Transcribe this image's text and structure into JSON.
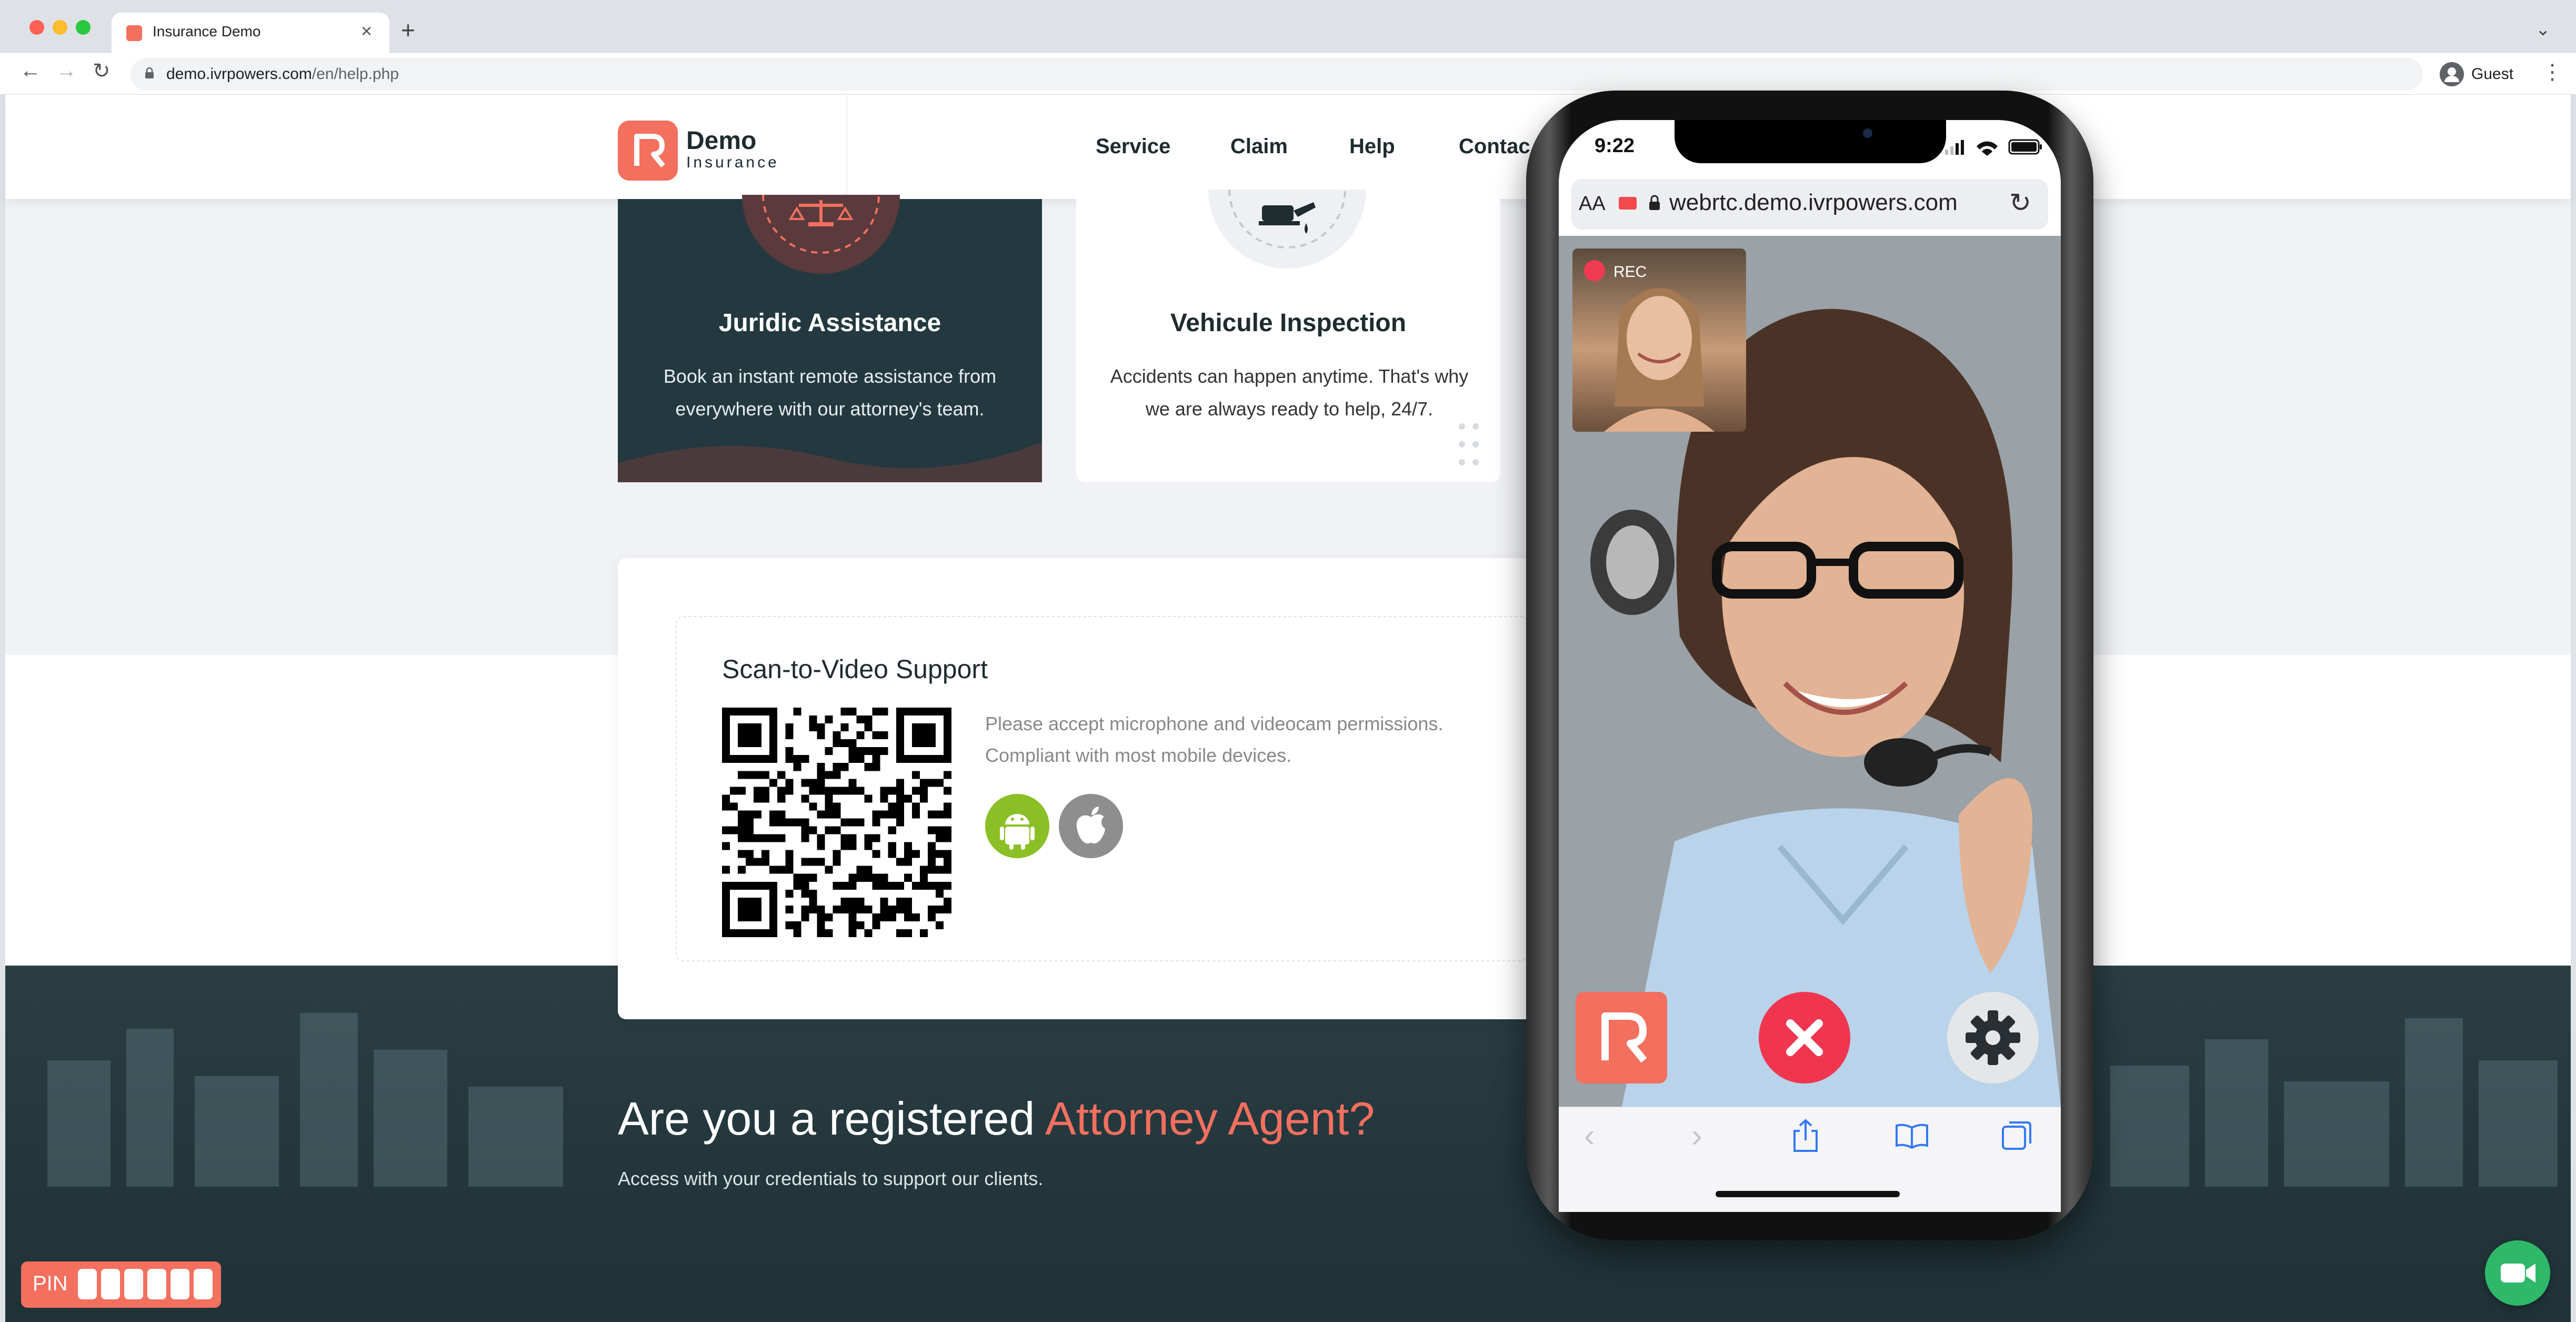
{
  "browser": {
    "tab_title": "Insurance Demo",
    "tab_close": "×",
    "new_tab": "+",
    "tab_menu": "⌄",
    "url_host": "demo.ivrpowers.com",
    "url_path": "/en/help.php",
    "profile_label": "Guest",
    "menu_glyph": "⋮",
    "back_glyph": "←",
    "forward_glyph": "→",
    "reload_glyph": "↻"
  },
  "site": {
    "logo_word1": "Demo",
    "logo_word2": "Insurance",
    "nav": [
      "Service",
      "Claim",
      "Help",
      "Contac"
    ],
    "cards": [
      {
        "title": "Juridic Assistance",
        "desc": "Book an instant remote assistance from everywhere with our attorney's team."
      },
      {
        "title": "Vehicule Inspection",
        "desc": "Accidents can happen anytime. That's why we are always ready to help, 24/7."
      }
    ],
    "scan": {
      "title": "Scan-to-Video Support",
      "desc_line1": "Please accept microphone and videocam permissions.",
      "desc_line2": "Compliant with most mobile devices."
    },
    "cta": {
      "title_plain": "Are you a registered ",
      "title_accent": "Attorney Agent?",
      "subtitle": "Access with your credentials to support our clients."
    },
    "pin_label": "PIN"
  },
  "phone": {
    "time": "9:22",
    "aa": "AA",
    "url": "webrtc.demo.ivrpowers.com",
    "reload_glyph": "↻",
    "rec_label": "REC",
    "toolbar": {
      "back": "‹",
      "forward": "›"
    }
  },
  "colors": {
    "brand": "#f36f5e",
    "dark_teal": "#23393f",
    "hangup_red": "#f0364f",
    "android_green": "#8bbf26",
    "video_fab_green": "#2fb86a"
  },
  "icons": [
    "shield-icon",
    "scale-icon",
    "car-wash-icon",
    "android-icon",
    "apple-icon",
    "video-camera-icon",
    "close-icon",
    "gear-icon",
    "share-icon",
    "book-icon",
    "tabs-icon"
  ]
}
